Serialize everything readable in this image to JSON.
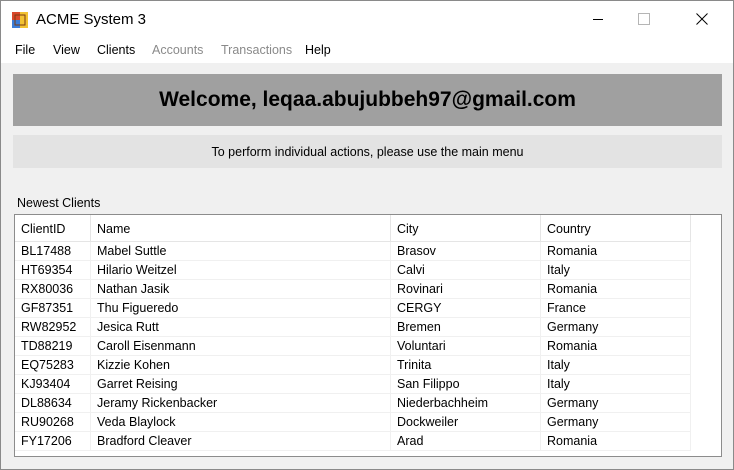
{
  "window": {
    "title": "ACME System 3"
  },
  "menu": [
    {
      "label": "File",
      "enabled": true
    },
    {
      "label": "View",
      "enabled": true
    },
    {
      "label": "Clients",
      "enabled": true
    },
    {
      "label": "Accounts",
      "enabled": false
    },
    {
      "label": "Transactions",
      "enabled": false
    },
    {
      "label": "Help",
      "enabled": true
    }
  ],
  "welcome": {
    "text": "Welcome, leqaa.abujubbeh97@gmail.com"
  },
  "info": {
    "text": "To perform individual actions, please use the main menu"
  },
  "clients": {
    "label": "Newest Clients",
    "columns": [
      "ClientID",
      "Name",
      "City",
      "Country"
    ],
    "rows": [
      [
        "BL17488",
        "Mabel Suttle",
        "Brasov",
        "Romania"
      ],
      [
        "HT69354",
        "Hilario Weitzel",
        "Calvi",
        "Italy"
      ],
      [
        "RX80036",
        "Nathan Jasik",
        "Rovinari",
        "Romania"
      ],
      [
        "GF87351",
        "Thu Figueredo",
        "CERGY",
        "France"
      ],
      [
        "RW82952",
        "Jesica Rutt",
        "Bremen",
        "Germany"
      ],
      [
        "TD88219",
        "Caroll Eisenmann",
        "Voluntari",
        "Romania"
      ],
      [
        "EQ75283",
        "Kizzie Kohen",
        "Trinita",
        "Italy"
      ],
      [
        "KJ93404",
        "Garret Reising",
        "San Filippo",
        "Italy"
      ],
      [
        "DL88634",
        "Jeramy Rickenbacker",
        "Niederbachheim",
        "Germany"
      ],
      [
        "RU90268",
        "Veda Blaylock",
        "Dockweiler",
        "Germany"
      ],
      [
        "FY17206",
        "Bradford Cleaver",
        "Arad",
        "Romania"
      ]
    ]
  }
}
